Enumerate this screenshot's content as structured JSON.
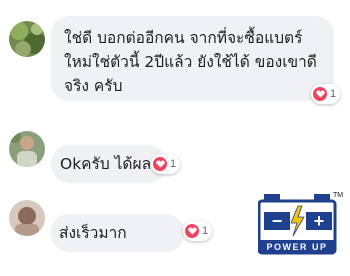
{
  "comments": [
    {
      "text": "ใช่ดี บอกต่ออีกคน จากที่จะซื้อแบตร์\nใหม่ใช่ตัวนี้ 2ปีแล้ว ยังใช้ได้ ของเขาดี\nจริง ครับ",
      "reaction_icon": "heart-icon",
      "reaction_count": "1"
    },
    {
      "text": "Okครับ ได้ผล",
      "reaction_icon": "heart-icon",
      "reaction_count": "1"
    },
    {
      "text": "ส่งเร็วมาก",
      "reaction_icon": "heart-icon",
      "reaction_count": "1"
    }
  ],
  "logo": {
    "brand_text": "POWER UP",
    "trademark": "TM",
    "minus_symbol": "−",
    "plus_symbol": "+"
  },
  "colors": {
    "bubble": "#eff1f4",
    "heart": "#f3425f",
    "logo_blue": "#1f3f8f",
    "logo_yellow": "#f5c400"
  }
}
